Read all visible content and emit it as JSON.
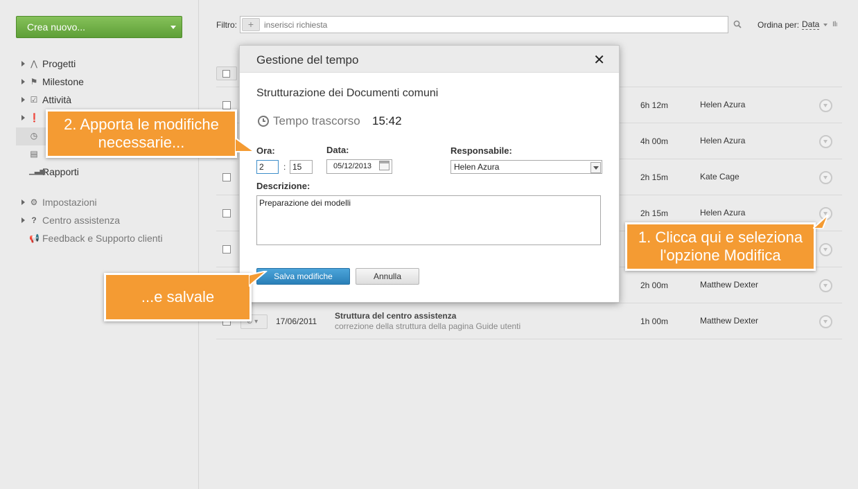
{
  "sidebar": {
    "create_button": "Crea nuovo...",
    "items": [
      {
        "label": "Progetti",
        "icon": "project-icon"
      },
      {
        "label": "Milestone",
        "icon": "flag-icon"
      },
      {
        "label": "Attività",
        "icon": "checkbox-icon"
      },
      {
        "label": "",
        "icon": "discussion-icon"
      },
      {
        "label": "",
        "icon": "clock-icon",
        "active": true
      },
      {
        "label": "",
        "icon": "document-icon"
      },
      {
        "label": "Rapporti",
        "icon": "chart-icon"
      }
    ],
    "secondary": [
      {
        "label": "Impostazioni",
        "icon": "gear-icon"
      },
      {
        "label": "Centro assistenza",
        "icon": "question-icon"
      },
      {
        "label": "Feedback e Supporto clienti",
        "icon": "megaphone-icon"
      }
    ]
  },
  "toolbar": {
    "filter_label": "Filtro:",
    "filter_placeholder": "inserisci richiesta",
    "sort_label": "Ordina per:",
    "sort_value": "Data"
  },
  "table": {
    "rows": [
      {
        "duration": "6h 12m",
        "person": "Helen Azura"
      },
      {
        "duration": "4h 00m",
        "person": "Helen Azura"
      },
      {
        "duration": "2h 15m",
        "person": "Kate Cage"
      },
      {
        "duration": "2h 15m",
        "person": "Helen Azura"
      },
      {
        "duration": "",
        "person": ""
      },
      {
        "duration": "2h 00m",
        "person": "Matthew Dexter"
      },
      {
        "date": "17/06/2011",
        "title": "Struttura del centro assistenza",
        "subtitle": "correzione della struttura della pagina Guide utenti",
        "duration": "1h 00m",
        "person": "Matthew Dexter"
      }
    ]
  },
  "modal": {
    "title": "Gestione del tempo",
    "task_name": "Strutturazione dei Documenti comuni",
    "elapsed_label": "Tempo trascorso",
    "elapsed_value": "15:42",
    "hour_label": "Ora:",
    "hour_value": "2",
    "minute_value": "15",
    "date_label": "Data:",
    "date_value": "05/12/2013",
    "responsible_label": "Responsabile:",
    "responsible_value": "Helen Azura",
    "description_label": "Descrizione:",
    "description_value": "Preparazione dei modelli",
    "save_label": "Salva modifiche",
    "cancel_label": "Annulla"
  },
  "callouts": {
    "step1_line1": "1. Clicca qui e seleziona",
    "step1_line2": "l'opzione Modifica",
    "step2_line1": "2. Apporta le modifiche",
    "step2_line2": "necessarie...",
    "step3": "...e salvale"
  },
  "colors": {
    "callout": "#f49b33",
    "create_button": "#6fae45",
    "save_button": "#2f8cc9"
  }
}
